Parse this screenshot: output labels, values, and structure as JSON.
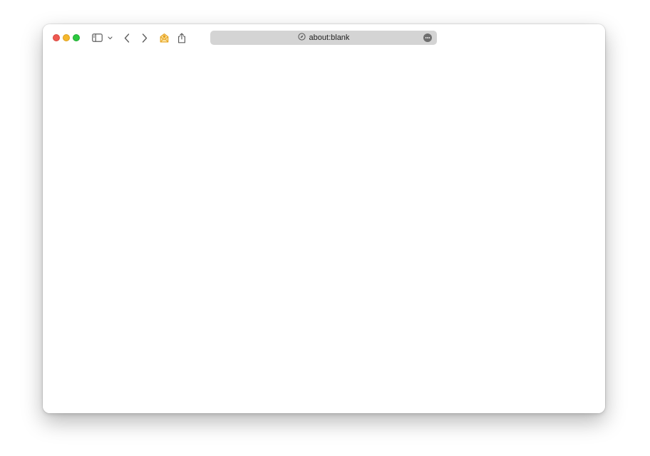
{
  "window": {
    "traffic_lights": {
      "close_color": "#ee5a52",
      "minimize_color": "#f5b82e",
      "zoom_color": "#2cc840"
    }
  },
  "toolbar": {
    "icons": {
      "sidebar": "sidebar-icon",
      "sidebar_menu": "chevron-down-icon",
      "back": "chevron-left-icon",
      "forward": "chevron-right-icon",
      "extension": "extension-icon",
      "share": "share-icon",
      "site": "compass-icon",
      "more": "more-icon"
    },
    "accent_color": "#e6a01a"
  },
  "address_bar": {
    "url": "about:blank"
  }
}
